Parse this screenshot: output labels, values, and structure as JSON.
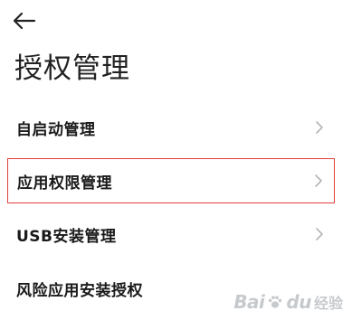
{
  "header": {
    "back_icon": "arrow-left-icon",
    "title": "授权管理"
  },
  "items": [
    {
      "label": "自启动管理",
      "icon": "chevron-right-icon",
      "highlighted": false
    },
    {
      "label": "应用权限管理",
      "icon": "chevron-right-icon",
      "highlighted": true
    },
    {
      "label": "USB安装管理",
      "icon": "chevron-right-icon",
      "highlighted": false
    },
    {
      "label": "风险应用安装授权",
      "icon": "chevron-right-icon",
      "highlighted": false
    }
  ],
  "watermark": {
    "logo": "Bai",
    "logo_suffix": "du",
    "sub": "经验"
  },
  "colors": {
    "highlight_border": "#e0413a",
    "chevron": "#b5b5b5",
    "text": "#1a1a1a"
  }
}
